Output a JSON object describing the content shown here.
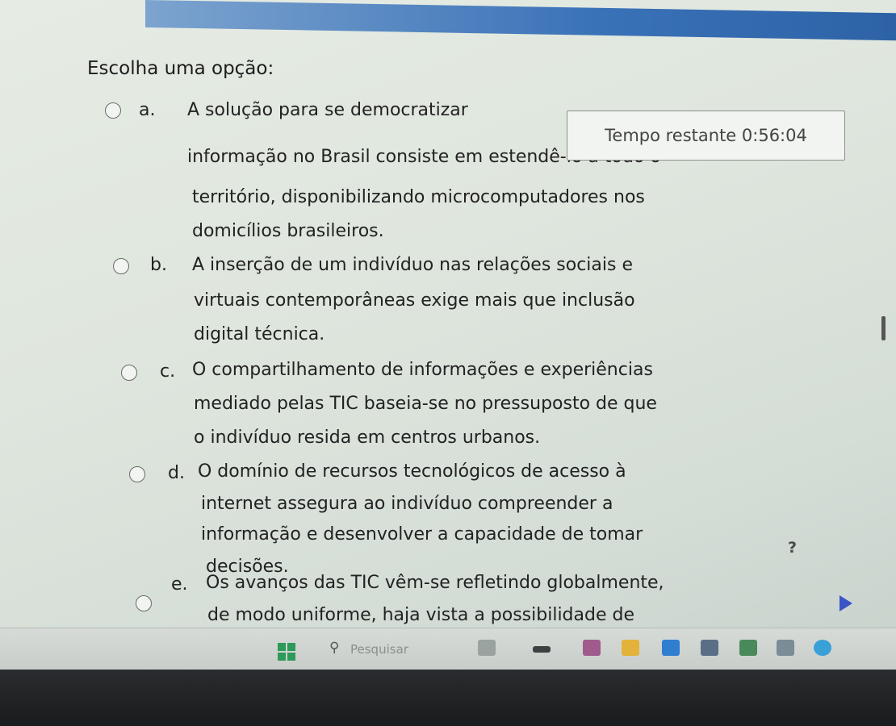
{
  "question": {
    "prompt": "Escolha uma opção:",
    "options": [
      {
        "letter": "a.",
        "lines": [
          "A solução para se democratizar",
          "informação no Brasil consiste em estendê-lo a todo o",
          "território, disponibilizando microcomputadores nos",
          "domicílios brasileiros."
        ]
      },
      {
        "letter": "b.",
        "lines": [
          "A inserção de um indivíduo nas relações sociais e",
          "virtuais contemporâneas exige mais que inclusão",
          "digital técnica."
        ]
      },
      {
        "letter": "c.",
        "lines": [
          "O compartilhamento de informações e experiências",
          "mediado pelas TIC baseia-se no pressuposto de que",
          "o indivíduo resida em centros urbanos."
        ]
      },
      {
        "letter": "d.",
        "lines": [
          "O domínio de recursos tecnológicos de acesso à",
          "internet assegura ao indivíduo compreender a",
          "informação e desenvolver a capacidade de tomar",
          "decisões."
        ]
      },
      {
        "letter": "e.",
        "lines": [
          "Os avanços das TIC vêm-se refletindo globalmente,",
          "de modo uniforme, haja vista a possibilidade de"
        ]
      }
    ]
  },
  "timer": {
    "label": "Tempo restante 0:56:04"
  },
  "help": {
    "label": "?"
  },
  "taskbar": {
    "search_placeholder": "Pesquisar"
  }
}
